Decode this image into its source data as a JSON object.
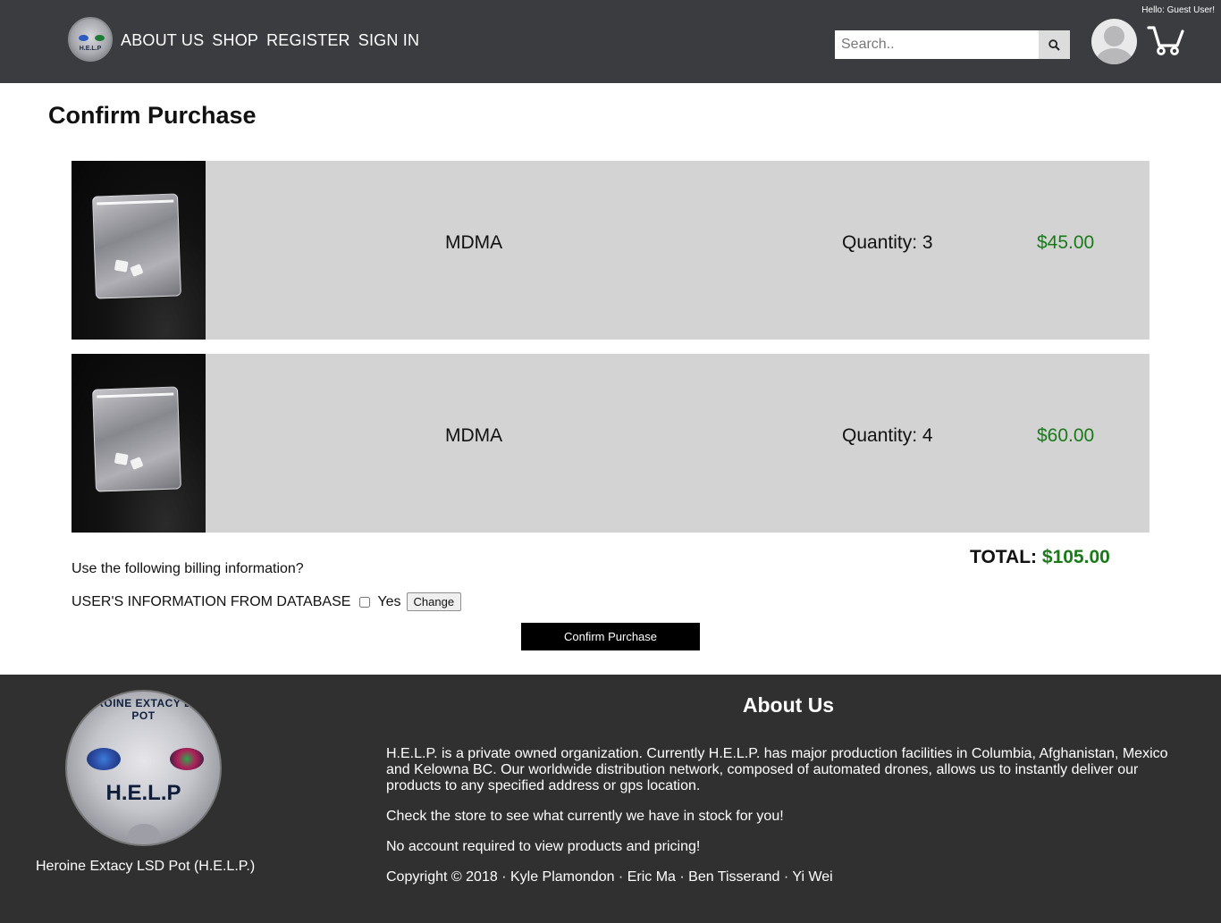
{
  "header": {
    "greeting": "Hello: Guest User!",
    "logo_text": "H.E.L.P",
    "nav": [
      "ABOUT US",
      "SHOP",
      "REGISTER",
      "SIGN IN"
    ],
    "search_placeholder": "Search..",
    "search_icon": "search-icon",
    "avatar_icon": "user-avatar-icon",
    "cart_icon": "shopping-cart-icon"
  },
  "main": {
    "title": "Confirm Purchase",
    "items": [
      {
        "name": "MDMA",
        "quantity": "Quantity: 3",
        "price": "$45.00"
      },
      {
        "name": "MDMA",
        "quantity": "Quantity: 4",
        "price": "$60.00"
      }
    ],
    "total_label": "TOTAL:",
    "total_amount": "$105.00",
    "billing_question": "Use the following billing information?",
    "billing_info": "USER'S INFORMATION FROM DATABASE",
    "yes_label": "Yes",
    "change_label": "Change",
    "confirm_label": "Confirm Purchase"
  },
  "footer": {
    "logo_ring": "HEROINE EXTACY LSD POT",
    "logo_brand": "H.E.L.P",
    "caption": "Heroine Extacy LSD Pot (H.E.L.P.)",
    "about_title": "About Us",
    "about_p1": "H.E.L.P. is a private owned organization. Currently H.E.L.P. has major production facilities in Columbia, Afghanistan, Mexico and Kelowna BC. Our worldwide distribution network, composed of automated drones, allows us to instantly deliver our products to any specified address or gps location.",
    "about_p2": "Check the store to see what currently we have in stock for you!",
    "about_p3": "No account required to view products and pricing!",
    "copyright": "Copyright © 2018 · Kyle Plamondon · Eric Ma · Ben Tisserand · Yi Wei"
  },
  "colors": {
    "header_bg": "#3b3c40",
    "footer_bg": "#303030",
    "item_bg": "#d3d3d3",
    "price_green": "#1a7a1a"
  }
}
